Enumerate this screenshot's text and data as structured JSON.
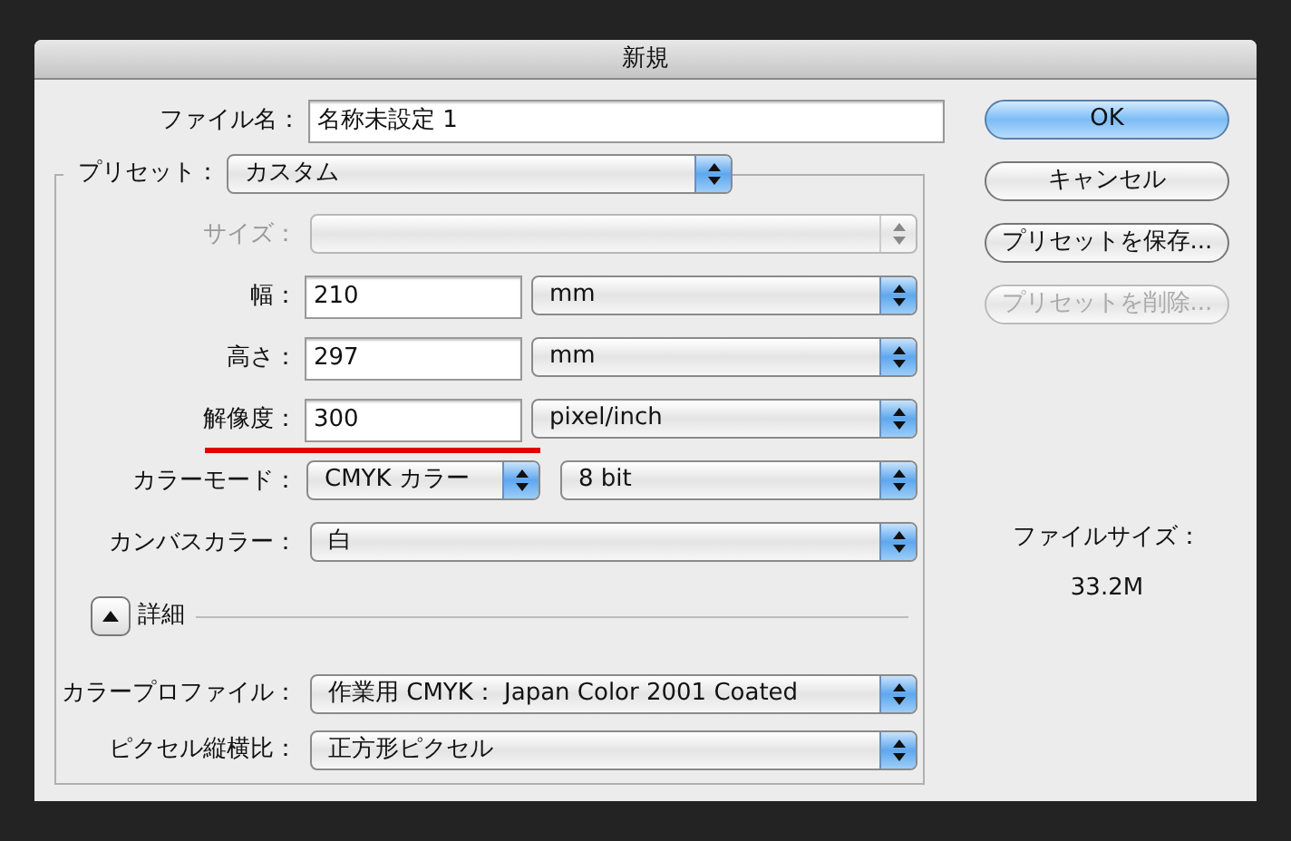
{
  "window": {
    "title": "新規"
  },
  "file_name": {
    "label": "ファイル名：",
    "value": "名称未設定 1"
  },
  "preset": {
    "label": "プリセット：",
    "value": "カスタム"
  },
  "fields": [
    {
      "kind": "select",
      "label": "サイズ：",
      "disabled": true,
      "underlined": false
    },
    {
      "kind": "input-select",
      "label": "幅：",
      "value": "210",
      "unit": "mm",
      "disabled": false,
      "underlined": false
    },
    {
      "kind": "input-select",
      "label": "高さ：",
      "value": "297",
      "unit": "mm",
      "disabled": false,
      "underlined": false
    },
    {
      "kind": "input-select",
      "label": "解像度：",
      "value": "300",
      "unit": "pixel/inch",
      "disabled": false,
      "underlined": true
    },
    {
      "kind": "select-select",
      "label": "カラーモード：",
      "value": "CMYK カラー",
      "unit": "8 bit",
      "disabled": false,
      "underlined": false
    },
    {
      "kind": "select",
      "label": "カンバスカラー：",
      "value": "白",
      "disabled": false,
      "underlined": false
    }
  ],
  "advanced": {
    "label": "詳細",
    "expanded": true
  },
  "advanced_fields": [
    {
      "label": "カラープロファイル：",
      "value": "作業用 CMYK： Japan Color 2001 Coated"
    },
    {
      "label": "ピクセル縦横比：",
      "value": "正方形ピクセル"
    }
  ],
  "buttons": [
    {
      "label": "OK",
      "default": true,
      "disabled": false
    },
    {
      "label": "キャンセル",
      "default": false,
      "disabled": false
    },
    {
      "label": "プリセットを保存...",
      "default": false,
      "disabled": false
    },
    {
      "label": "プリセットを削除...",
      "default": false,
      "disabled": true
    }
  ],
  "file_size": {
    "label": "ファイルサイズ：",
    "value": "33.2M"
  }
}
